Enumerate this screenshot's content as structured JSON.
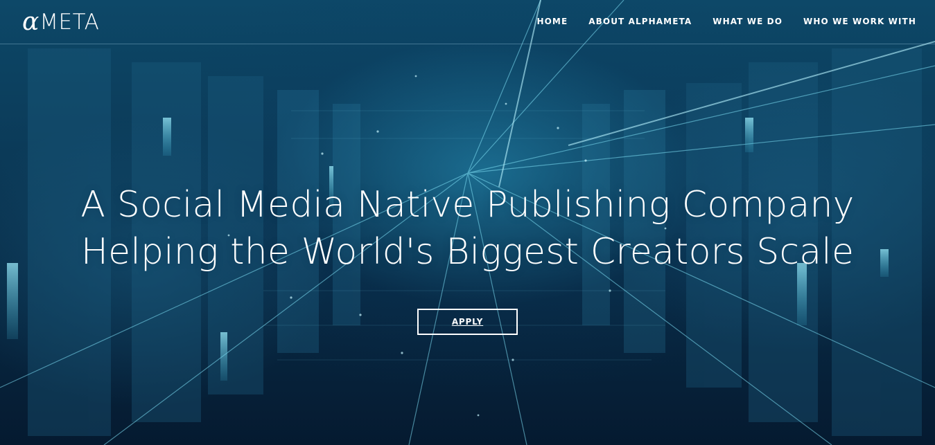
{
  "header": {
    "logo_symbol": "α",
    "logo_text": "META",
    "nav": [
      {
        "label": "HOME"
      },
      {
        "label": "ABOUT ALPHAMETA"
      },
      {
        "label": "WHAT WE DO"
      },
      {
        "label": "WHO WE WORK WITH"
      }
    ]
  },
  "hero": {
    "headline_line1": "A Social Media Native Publishing Company",
    "headline_line2": "Helping the World's Biggest Creators Scale",
    "apply_label": "APPLY"
  },
  "colors": {
    "background": "#0b3a58",
    "accent_glow": "#5fd0e8",
    "text": "#ffffff"
  }
}
